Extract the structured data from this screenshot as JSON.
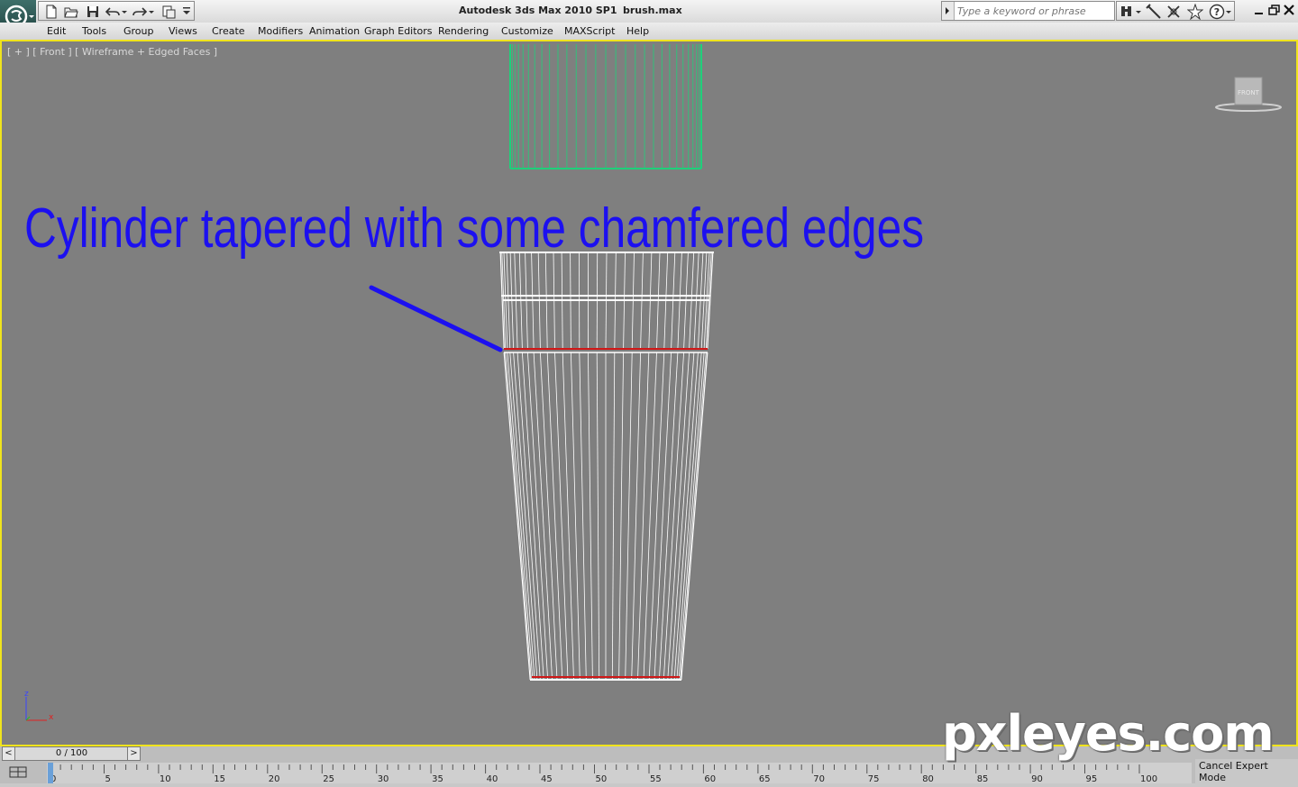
{
  "window": {
    "app_title": "Autodesk 3ds Max  2010 SP1",
    "file_name": "brush.max"
  },
  "search": {
    "placeholder": "Type a keyword or phrase"
  },
  "menu": [
    "Edit",
    "Tools",
    "Group",
    "Views",
    "Create",
    "Modifiers",
    "Animation",
    "Graph Editors",
    "Rendering",
    "Customize",
    "MAXScript",
    "Help"
  ],
  "viewport": {
    "label": "[ + ] [ Front ] [ Wireframe + Edged Faces ]",
    "viewcube_label": "FRONT",
    "axis_z": "z",
    "axis_x": "x",
    "annotation": "Cylinder tapered with some chamfered edges"
  },
  "timeline": {
    "slider_prev": "<",
    "slider_value": "0 / 100",
    "slider_next": ">",
    "ticks": [
      "0",
      "5",
      "10",
      "15",
      "20",
      "25",
      "30",
      "35",
      "40",
      "45",
      "50",
      "55",
      "60",
      "65",
      "70",
      "75",
      "80",
      "85",
      "90",
      "95",
      "100"
    ]
  },
  "status": {
    "cancel_expert_mode": "Cancel Expert Mode"
  },
  "watermark": "pxleyes.com",
  "colors": {
    "viewport_bg": "#7f7f7f",
    "viewport_border": "#f0e41c",
    "wire_white": "#ffffff",
    "wire_green": "#1fd07a",
    "chamfer_red": "#d01818",
    "annotation_blue": "#1c10f0"
  }
}
